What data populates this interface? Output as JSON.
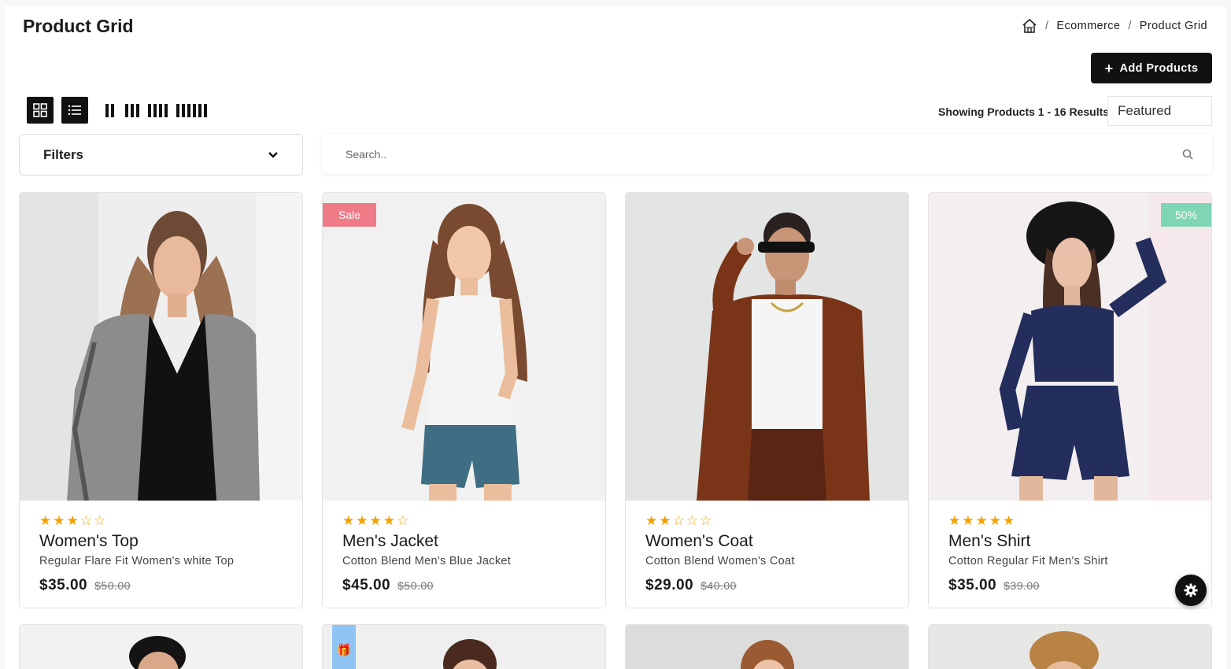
{
  "header": {
    "title": "Product Grid",
    "breadcrumb": [
      "Ecommerce",
      "Product Grid"
    ],
    "add_button": "Add Products"
  },
  "toolbar": {
    "showing": "Showing Products 1 - 16 Results",
    "sort_value": "Featured",
    "filters_label": "Filters",
    "search_placeholder": "Search.."
  },
  "products": [
    {
      "name": "Women's Top",
      "desc": "Regular Flare Fit Women's white Top",
      "price": "$35.00",
      "old_price": "$50.00",
      "rating": 3,
      "badge": ""
    },
    {
      "name": "Men's Jacket",
      "desc": "Cotton Blend Men's Blue Jacket",
      "price": "$45.00",
      "old_price": "$50.00",
      "rating": 4,
      "badge": "Sale"
    },
    {
      "name": "Women's Coat",
      "desc": "Cotton Blend Women's Coat",
      "price": "$29.00",
      "old_price": "$40.00",
      "rating": 2,
      "badge": ""
    },
    {
      "name": "Men's Shirt",
      "desc": "Cotton Regular Fit Men's Shirt",
      "price": "$35.00",
      "old_price": "$39.00",
      "rating": 5,
      "badge": "50%"
    }
  ],
  "colors": {
    "sale_badge": "#ef7b86",
    "percent_badge": "#7fd6b4",
    "gift_badge": "#8ec5f5",
    "star": "#f5a000"
  },
  "icons": [
    "home-icon",
    "grid-icon",
    "list-icon",
    "chevron-down-icon",
    "search-icon",
    "plus-icon",
    "gear-icon",
    "star-icon",
    "gift-icon"
  ]
}
